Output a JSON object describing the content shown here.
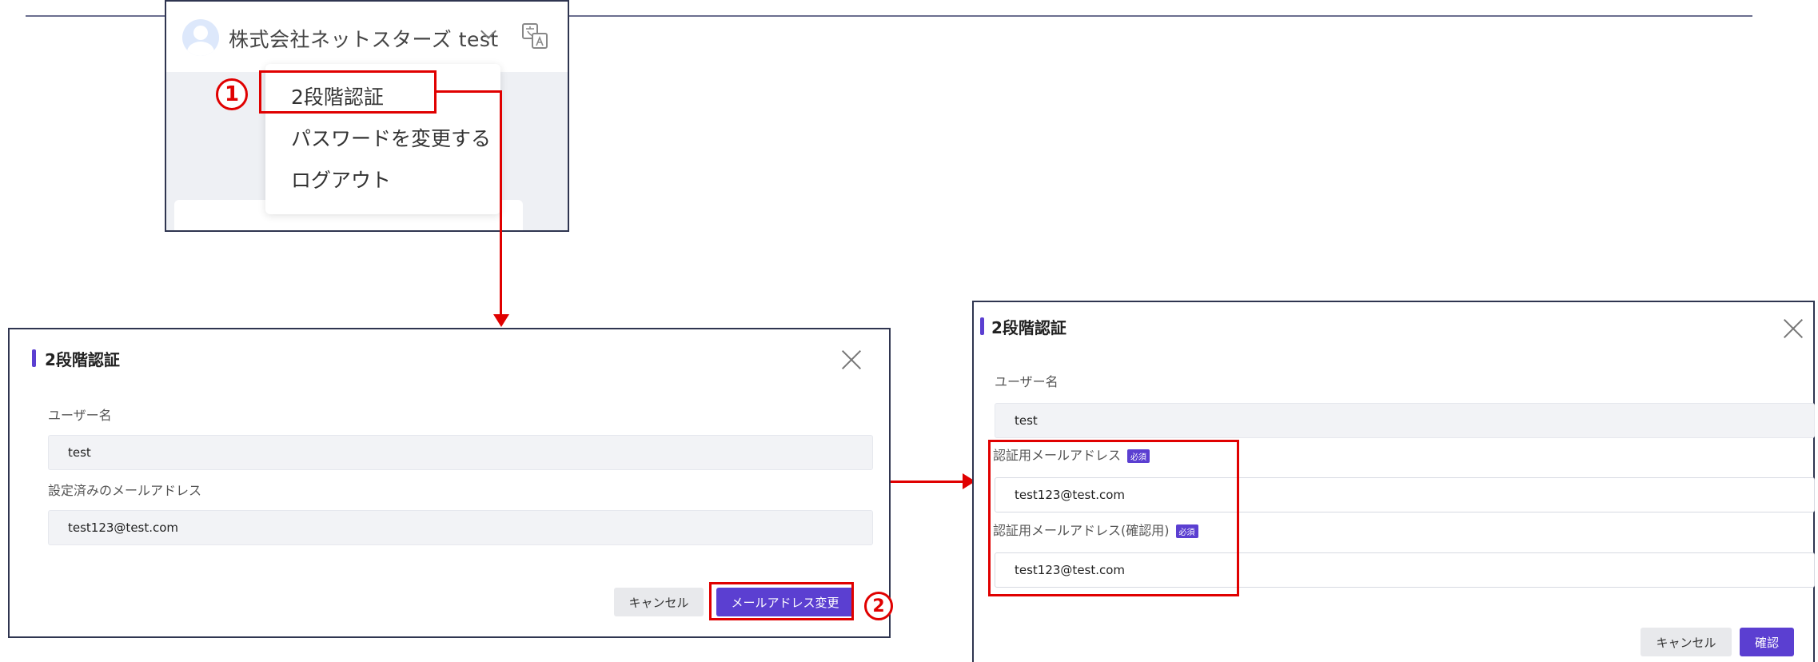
{
  "header": {
    "company_name": "株式会社ネットスターズ test",
    "icons": {
      "avatar": "user-avatar-icon",
      "chevron": "chevron-down-icon",
      "translate": "translate-icon"
    }
  },
  "user_menu": {
    "items": [
      "2段階認証",
      "パスワードを変更する",
      "ログアウト"
    ]
  },
  "annotations": {
    "step1": "1",
    "step2": "2",
    "accent_color": "#e00000"
  },
  "dialog_current": {
    "title": "2段階認証",
    "username_label": "ユーザー名",
    "username_value": "test",
    "email_label": "設定済みのメールアドレス",
    "email_value": "test123@test.com",
    "cancel_label": "キャンセル",
    "change_email_label": "メールアドレス変更"
  },
  "dialog_change": {
    "title": "2段階認証",
    "username_label": "ユーザー名",
    "username_value": "test",
    "email_label": "認証用メールアドレス",
    "email_value": "test123@test.com",
    "email_confirm_label": "認証用メールアドレス(確認用)",
    "email_confirm_value": "test123@test.com",
    "required_badge": "必須",
    "cancel_label": "キャンセル",
    "confirm_label": "確認"
  },
  "colors": {
    "primary": "#5b3fd1",
    "annotation_red": "#e00000",
    "frame": "#2f3550"
  }
}
